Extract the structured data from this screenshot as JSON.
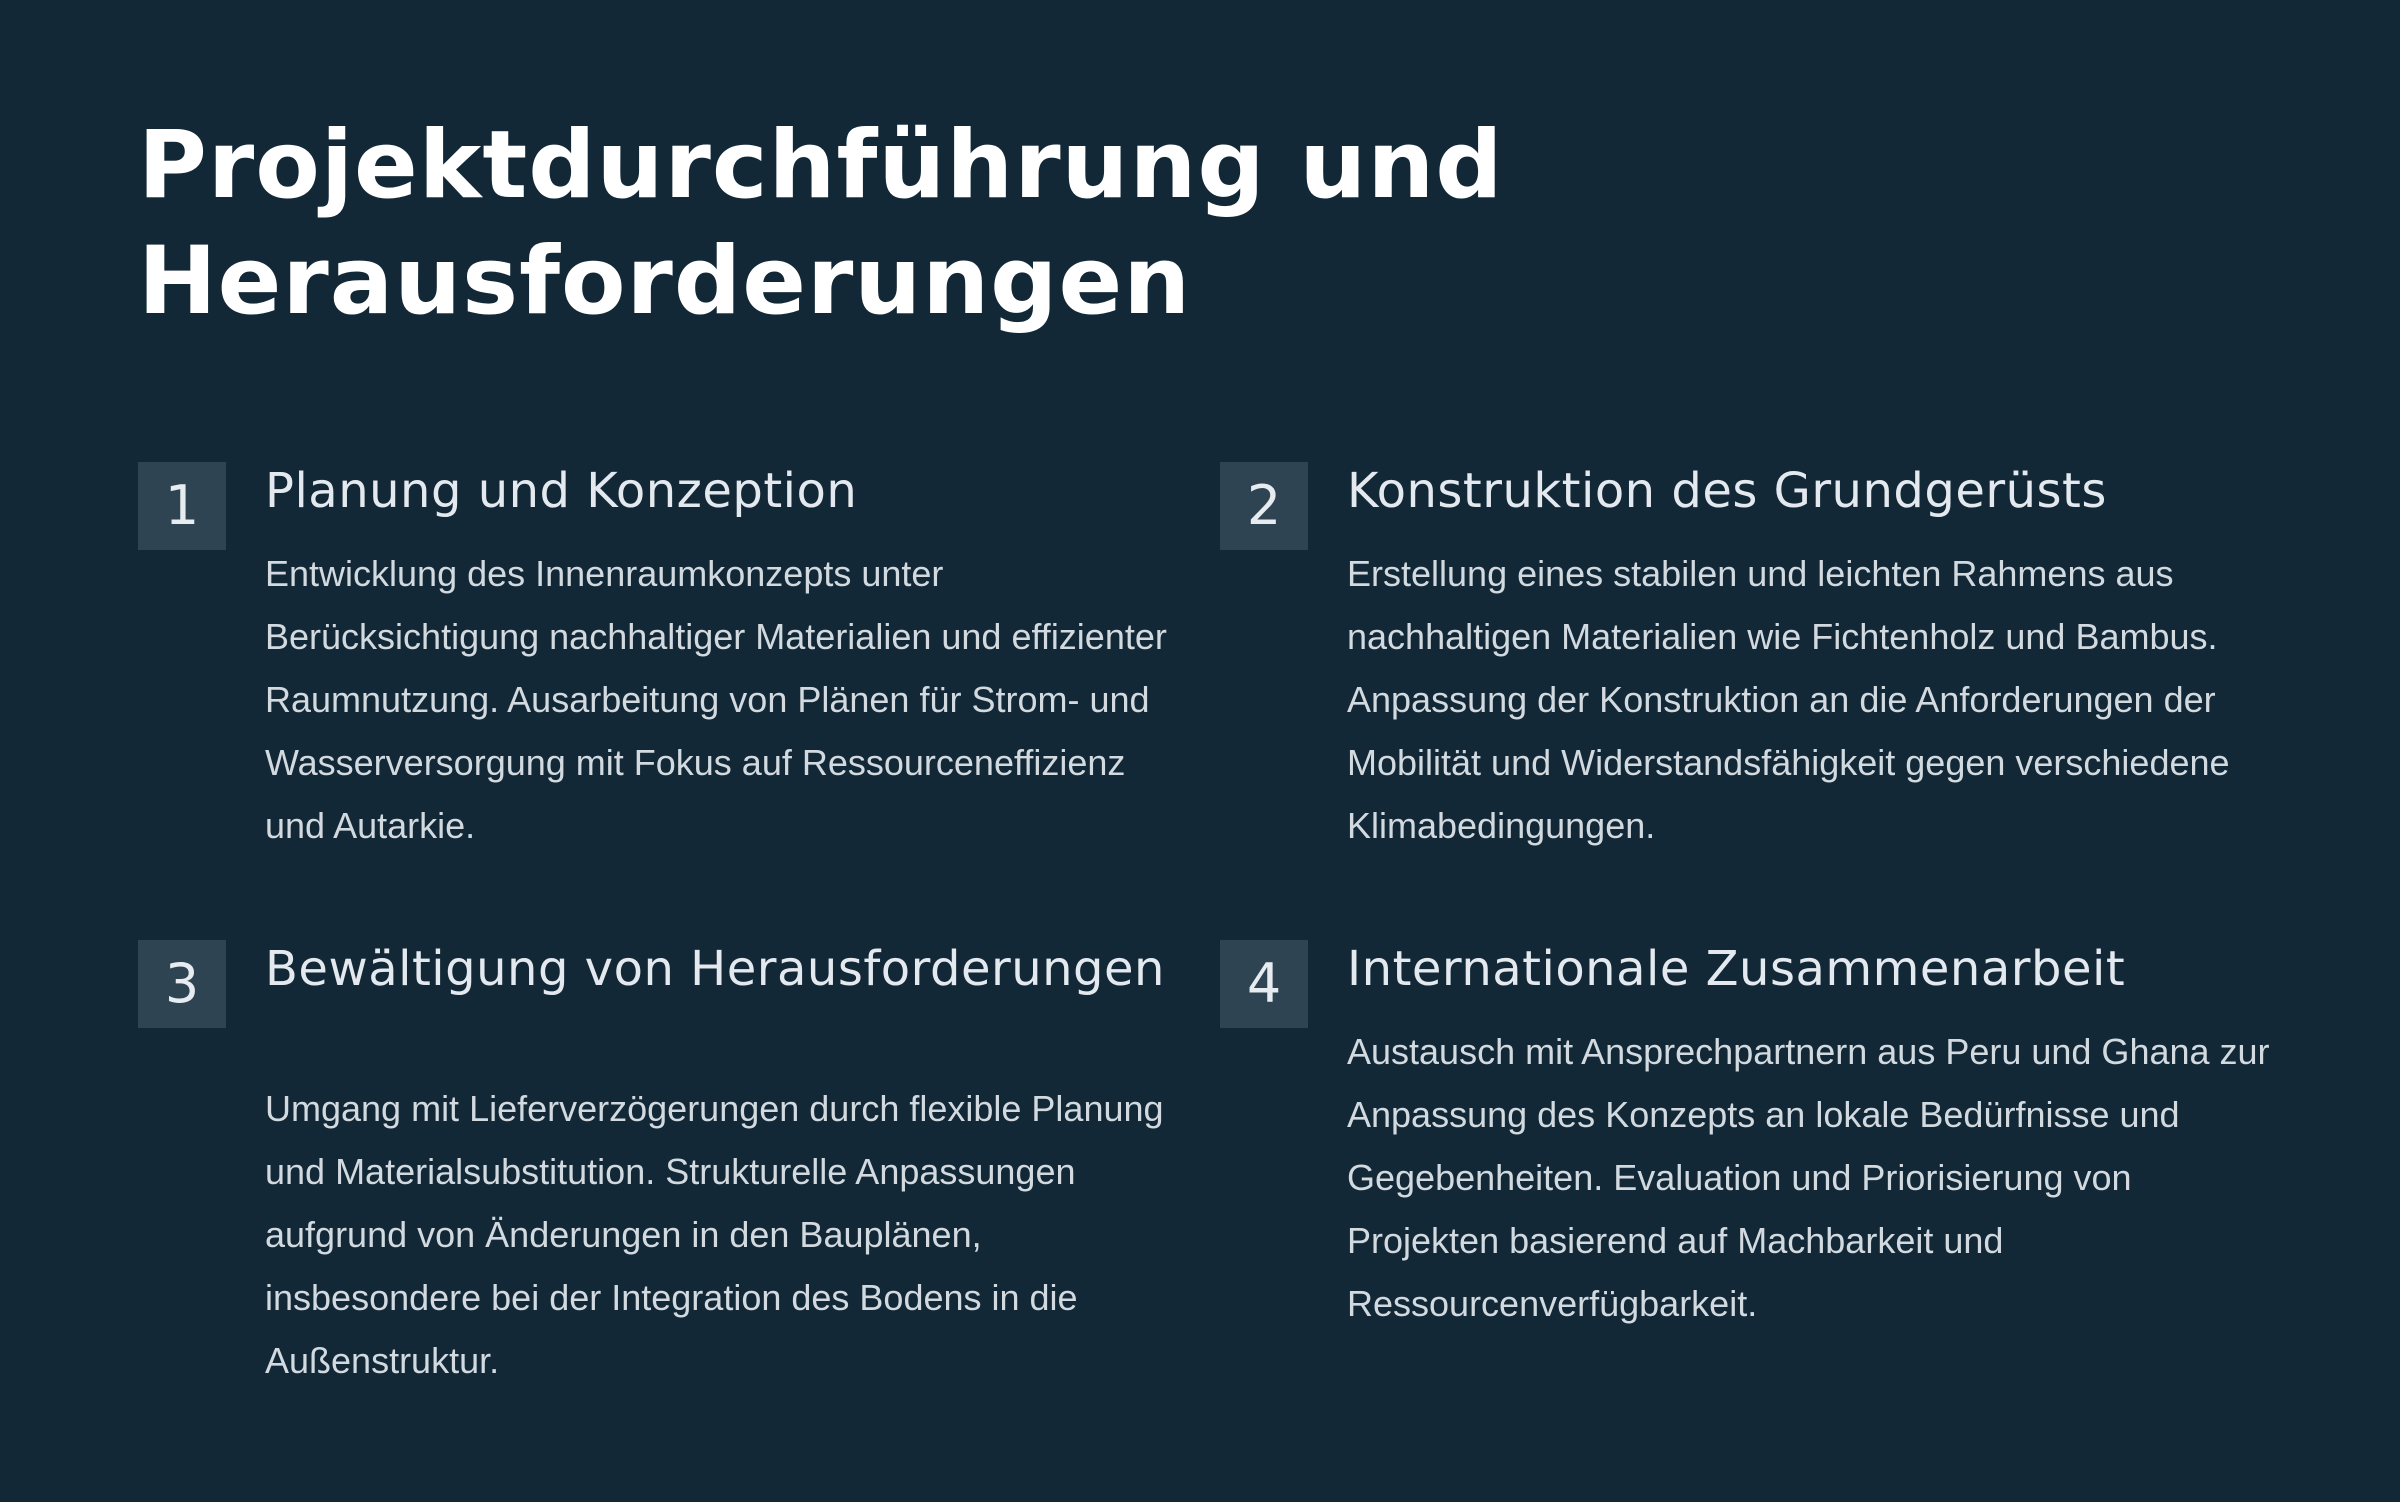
{
  "title": "Projektdurchführung und Herausforderungen",
  "steps": [
    {
      "number": "1",
      "heading": "Planung und Konzeption",
      "text": "Entwicklung des Innenraumkonzepts unter Berücksichtigung nachhaltiger Materialien und effizienter Raumnutzung. Ausarbeitung von Plänen für Strom- und Wasserversorgung mit Fokus auf Ressourceneffizienz und Autarkie."
    },
    {
      "number": "2",
      "heading": "Konstruktion des Grundgerüsts",
      "text": "Erstellung eines stabilen und leichten Rahmens aus nachhaltigen Materialien wie Fichtenholz und Bambus. Anpassung der Konstruktion an die Anforderungen der Mobilität und Widerstandsfähigkeit gegen verschiedene Klimabedingungen."
    },
    {
      "number": "3",
      "heading": "Bewältigung von Herausforderungen",
      "text": "Umgang mit Lieferverzögerungen durch flexible Planung und Materialsubstitution. Strukturelle Anpassungen aufgrund von Änderungen in den Bauplänen, insbesondere bei der Integration des Bodens in die Außenstruktur."
    },
    {
      "number": "4",
      "heading": "Internationale Zusammenarbeit",
      "text": "Austausch mit Ansprechpartnern aus Peru und Ghana zur Anpassung des Konzepts an lokale Bedürfnisse und Gegebenheiten. Evaluation und Priorisierung von Projekten basierend auf Machbarkeit und Ressourcenverfügbarkeit."
    }
  ],
  "colors": {
    "background": "#132837",
    "badge": "#2f4453",
    "title": "#ffffff",
    "heading": "#e3e9ee",
    "body_text": "#d2dae0"
  }
}
